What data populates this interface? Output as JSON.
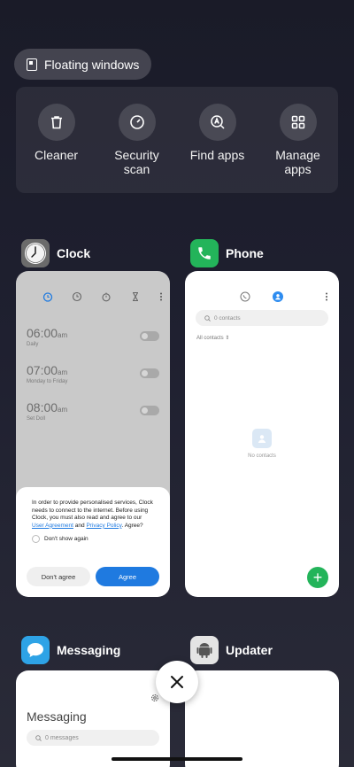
{
  "floating_windows": {
    "label": "Floating windows"
  },
  "tools": [
    {
      "label": "Cleaner",
      "icon": "trash-icon"
    },
    {
      "label": "Security scan",
      "icon": "security-gauge-icon"
    },
    {
      "label": "Find apps",
      "icon": "find-apps-icon"
    },
    {
      "label": "Manage apps",
      "icon": "grid-icon"
    }
  ],
  "apps": {
    "clock": {
      "name": "Clock",
      "alarms": [
        {
          "time": "06:00",
          "ampm": "am",
          "sub": "Daily"
        },
        {
          "time": "07:00",
          "ampm": "am",
          "sub": "Monday to Friday"
        },
        {
          "time": "08:00",
          "ampm": "am",
          "sub": "Set Doll"
        }
      ],
      "dialog": {
        "text": "In order to provide personalised services, Clock needs to connect to the internet. Before using Clock, you must also read and agree to our",
        "link1": "User Agreement",
        "and": "and",
        "link2": "Privacy Policy",
        "tail": ". Agree?",
        "checkbox": "Don't show again",
        "cancel": "Don't agree",
        "agree": "Agree"
      }
    },
    "phone": {
      "name": "Phone",
      "search_placeholder": "0 contacts",
      "filter": "All contacts",
      "empty": "No contacts",
      "fab": "+"
    },
    "messaging": {
      "name": "Messaging",
      "title": "Messaging",
      "search_placeholder": "0 messages"
    },
    "updater": {
      "name": "Updater"
    }
  },
  "colors": {
    "accent_blue": "#1f7ae0",
    "phone_green": "#23b45a",
    "messaging_blue": "#2ea3e6"
  }
}
